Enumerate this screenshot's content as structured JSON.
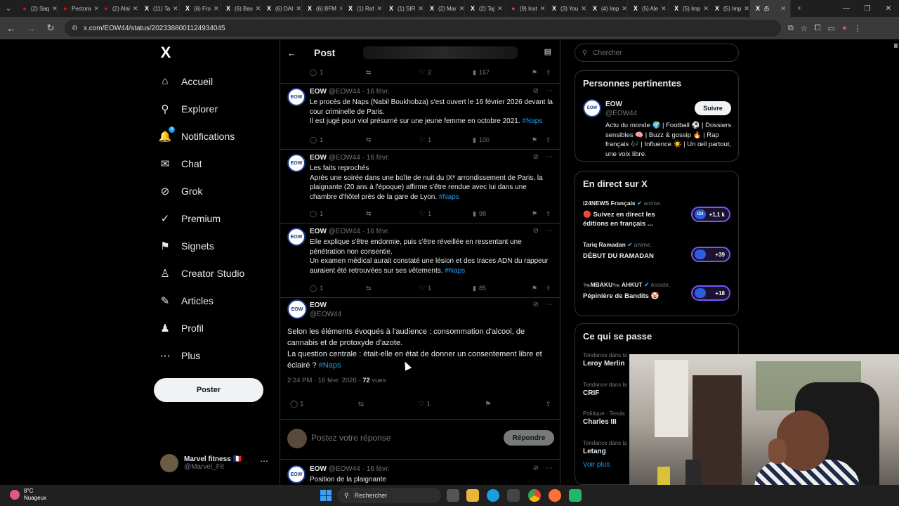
{
  "browser": {
    "tabs": [
      {
        "label": "(2) Saq",
        "icon": "youtube-icon",
        "color": "#ff0000"
      },
      {
        "label": "Pectora",
        "icon": "youtube-icon",
        "color": "#ff0000"
      },
      {
        "label": "(2) Alai",
        "icon": "youtube-icon",
        "color": "#ff0000"
      },
      {
        "label": "(11) Ta",
        "icon": "x-icon",
        "color": "#ffffff"
      },
      {
        "label": "(6) Fro",
        "icon": "x-icon",
        "color": "#ffffff"
      },
      {
        "label": "(6) Bas",
        "icon": "x-icon",
        "color": "#ffffff"
      },
      {
        "label": "(6) DAI",
        "icon": "x-icon",
        "color": "#ffffff"
      },
      {
        "label": "(6) BFM",
        "icon": "x-icon",
        "color": "#ffffff"
      },
      {
        "label": "(1) Raf",
        "icon": "x-icon",
        "color": "#ffffff"
      },
      {
        "label": "(1) SIR",
        "icon": "x-icon",
        "color": "#ffffff"
      },
      {
        "label": "(2) Mar",
        "icon": "x-icon",
        "color": "#ffffff"
      },
      {
        "label": "(2) Taj",
        "icon": "x-icon",
        "color": "#ffffff"
      },
      {
        "label": "(9) Inst",
        "icon": "instagram-icon",
        "color": "#e1306c"
      },
      {
        "label": "(3) You",
        "icon": "x-icon",
        "color": "#ffffff"
      },
      {
        "label": "(4) Imp",
        "icon": "x-icon",
        "color": "#ffffff"
      },
      {
        "label": "(5) Ale",
        "icon": "x-icon",
        "color": "#ffffff"
      },
      {
        "label": "(5) Imp",
        "icon": "x-icon",
        "color": "#ffffff"
      },
      {
        "label": "(5) Imp",
        "icon": "x-icon",
        "color": "#ffffff"
      },
      {
        "label": "(5",
        "icon": "x-icon",
        "color": "#ffffff",
        "active": true
      }
    ],
    "url": "x.com/EOW44/status/2023388001124934045"
  },
  "nav": {
    "logo": "X",
    "items": [
      {
        "label": "Accueil",
        "icon": "home-icon",
        "glyph": "⌂"
      },
      {
        "label": "Explorer",
        "icon": "search-icon",
        "glyph": "⚲"
      },
      {
        "label": "Notifications",
        "icon": "bell-icon",
        "glyph": "🔔",
        "badge": "8"
      },
      {
        "label": "Chat",
        "icon": "mail-icon",
        "glyph": "✉"
      },
      {
        "label": "Grok",
        "icon": "grok-icon",
        "glyph": "⊘"
      },
      {
        "label": "Premium",
        "icon": "premium-icon",
        "glyph": "✓"
      },
      {
        "label": "Signets",
        "icon": "bookmark-icon",
        "glyph": "⚑"
      },
      {
        "label": "Creator Studio",
        "icon": "flask-icon",
        "glyph": "♙"
      },
      {
        "label": "Articles",
        "icon": "articles-icon",
        "glyph": "✎"
      },
      {
        "label": "Profil",
        "icon": "profile-icon",
        "glyph": "♟"
      },
      {
        "label": "Plus",
        "icon": "more-circle-icon",
        "glyph": "⋯"
      }
    ],
    "post_label": "Poster",
    "account": {
      "name": "Marvel fitness 🇫🇷",
      "handle": "@Marvel_Fit"
    }
  },
  "header": {
    "title": "Post"
  },
  "thread": [
    {
      "author": "EOW",
      "handle": "@EOW44",
      "date": "16 févr.",
      "text": "Le procès de Naps (Nabil Boukhobza) s'est ouvert le 16 février 2026 devant la cour criminelle de Paris.\nIl est jugé pour viol présumé sur une jeune femme en octobre 2021. ",
      "tag": "#Naps",
      "replies": "1",
      "likes": "1",
      "views": "100"
    },
    {
      "author": "EOW",
      "handle": "@EOW44",
      "date": "16 févr.",
      "text": "Les faits reprochés\nAprès une soirée dans une boîte de nuit du IXᵉ arrondissement de Paris, la plaignante (20 ans à l'époque) affirme s'être rendue avec lui dans une chambre d'hôtel près de la gare de Lyon. ",
      "tag": "#Naps",
      "replies": "1",
      "likes": "1",
      "views": "98"
    },
    {
      "author": "EOW",
      "handle": "@EOW44",
      "date": "16 févr.",
      "text": "Elle explique s'être endormie, puis s'être réveillée en ressentant une pénétration non consentie.\nUn examen médical aurait constaté une lésion et des traces ADN du rappeur auraient été retrouvées sur ses vêtements. ",
      "tag": "#Naps",
      "replies": "1",
      "likes": "1",
      "views": "85"
    }
  ],
  "top_actions": {
    "replies": "1",
    "likes": "2",
    "views": "167"
  },
  "main_tweet": {
    "author": "EOW",
    "handle": "@EOW44",
    "text": "Selon les éléments évoqués à l'audience : consommation d'alcool, de cannabis et de protoxyde d'azote.\nLa question centrale : était-elle en état de donner un consentement libre et éclairé ? ",
    "tag": "#Naps",
    "time": "2:24 PM · 16 févr. 2026 · ",
    "views_count": "72",
    "views_label": " vues",
    "replies": "1",
    "likes": "1"
  },
  "reply_box": {
    "placeholder": "Postez votre réponse",
    "button": "Répondre"
  },
  "next_tweet": {
    "author": "EOW",
    "handle": "@EOW44",
    "date": "16 févr.",
    "text": "Position de la plaignante"
  },
  "sidebar": {
    "search_placeholder": "Chercher",
    "relevant": {
      "title": "Personnes pertinentes",
      "name": "EOW",
      "handle": "@EOW44",
      "follow": "Suivre",
      "bio": "Actu du monde 🌍 | Football ⚽ | Dossiers sensibles 🧠 | Buzz & gossip 🔥 | Rap français 🎶 | Influence ☀️ | Un œil partout, une voix libre."
    },
    "live": {
      "title": "En direct sur X",
      "items": [
        {
          "host": "i24NEWS Français",
          "role": " anime.",
          "title": "🔴 Suivez en direct les éditions en français ...",
          "count": "+1,1 k",
          "av": "i24"
        },
        {
          "host": "Tariq Ramadan",
          "role": " anime.",
          "title": "DÉBUT DU RAMADAN",
          "count": "+39",
          "av": ""
        },
        {
          "host": "🐜MBAKU🐜 AHKUT",
          "role": " écoute.",
          "title": "Pépinière de Bandits 🤡",
          "count": "+18",
          "av": ""
        }
      ]
    },
    "trends": {
      "title": "Ce qui se passe",
      "items": [
        {
          "context": "Tendance dans la",
          "name": "Leroy Merlin"
        },
        {
          "context": "Tendance dans la",
          "name": "CRIF"
        },
        {
          "context": "Politique · Tenda",
          "name": "Charles III"
        },
        {
          "context": "Tendance dans la",
          "name": "Letang"
        }
      ],
      "more": "Voir plus"
    }
  },
  "taskbar": {
    "temp": "8°C",
    "weather": "Nuageux",
    "search": "Rechercher"
  }
}
